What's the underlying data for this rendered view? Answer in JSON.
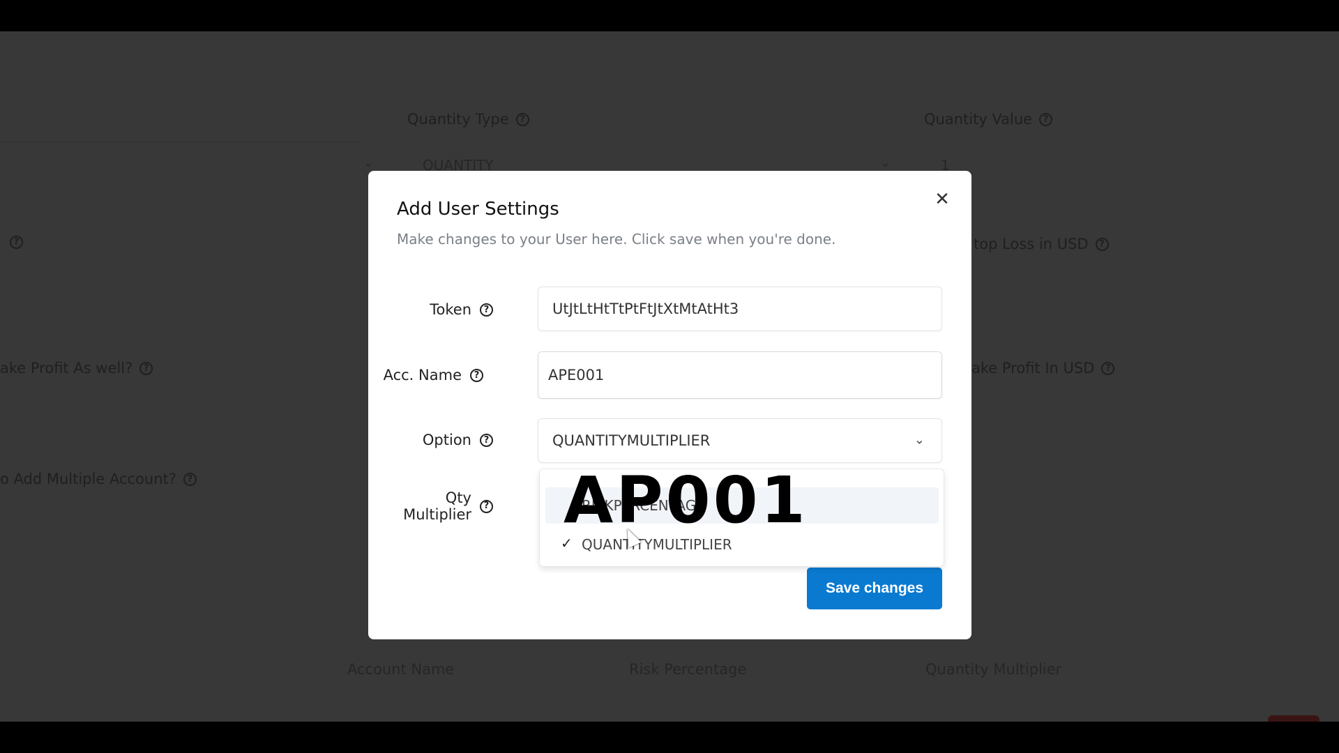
{
  "background": {
    "quantity_type_label": "Quantity Type",
    "quantity_type_value": "QUANTITY",
    "quantity_value_label": "Quantity Value",
    "quantity_value_value": "1",
    "stop_loss_label": "top Loss in USD",
    "take_profit_label": "ake Profit As well?",
    "take_profit_usd_label": "ake Profit In USD",
    "multiple_account_label": "o Add Multiple Account?",
    "table_headers": [
      "Account Name",
      "Risk Percentage",
      "Quantity Multiplier"
    ]
  },
  "dialog": {
    "title": "Add User Settings",
    "subtitle": "Make changes to your User here. Click save when you're done.",
    "close_icon": "close-icon",
    "fields": {
      "token": {
        "label": "Token",
        "value": "UtJtLtHtTtPtFtJtXtMtAtHt3"
      },
      "acc_name": {
        "label": "Acc. Name",
        "value": "APE001"
      },
      "option": {
        "label": "Option",
        "value": "QUANTITYMULTIPLIER"
      },
      "qty_multiplier": {
        "label_line1": "Qty",
        "label_line2": "Multiplier"
      }
    },
    "dropdown_options": [
      {
        "label": "RISKPERCENTAGE",
        "selected": false,
        "highlighted": true
      },
      {
        "label": "QUANTITYMULTIPLIER",
        "selected": true,
        "highlighted": false
      }
    ],
    "save_label": "Save changes"
  },
  "overlay_caption": "AP001",
  "colors": {
    "accent": "#0a7ad0",
    "backdrop": "#383838"
  }
}
